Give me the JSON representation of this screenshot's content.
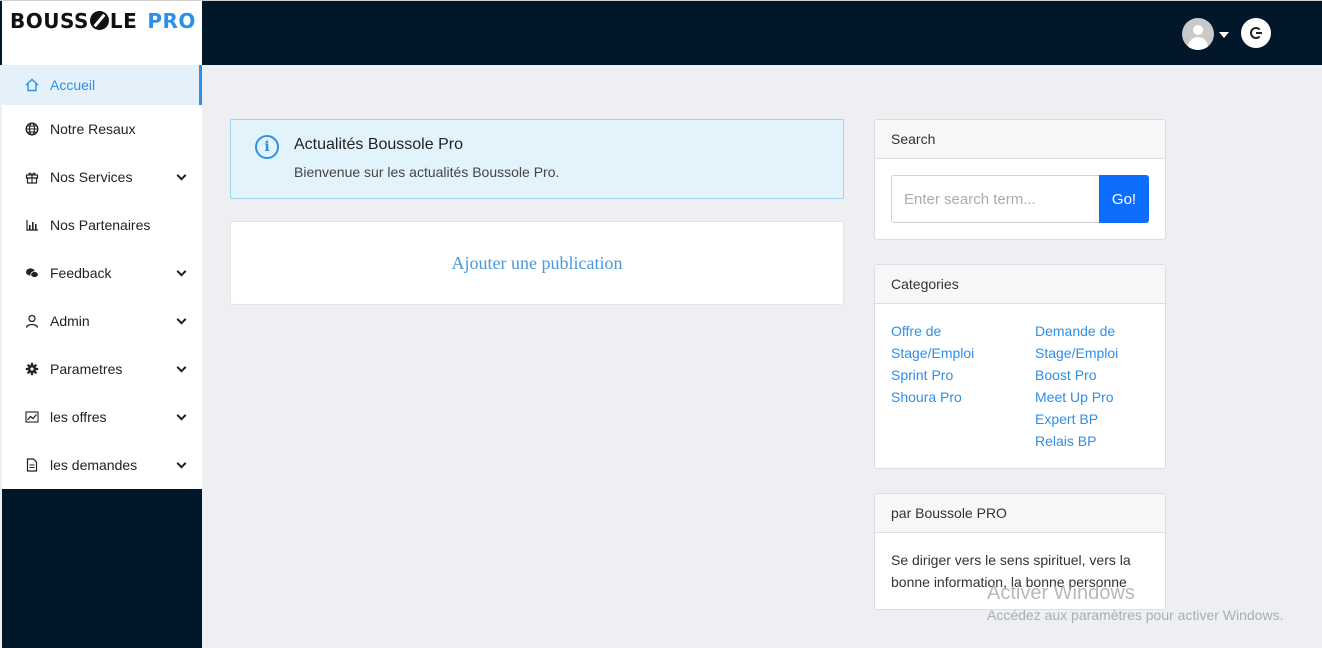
{
  "brand": {
    "name_part1": "BOUSS",
    "name_part2": "LE",
    "name_part3": "PRO"
  },
  "header": {
    "avatar_icon": "user-avatar-icon",
    "logout_icon": "logout-icon"
  },
  "sidebar": {
    "items": [
      {
        "label": "Accueil",
        "icon": "home-icon",
        "active": true,
        "expandable": false
      },
      {
        "label": "Notre Resaux",
        "icon": "globe-icon",
        "active": false,
        "expandable": false
      },
      {
        "label": "Nos Services",
        "icon": "gift-icon",
        "active": false,
        "expandable": true
      },
      {
        "label": "Nos Partenaires",
        "icon": "bar-chart-icon",
        "active": false,
        "expandable": false
      },
      {
        "label": "Feedback",
        "icon": "chat-icon",
        "active": false,
        "expandable": true
      },
      {
        "label": "Admin",
        "icon": "user-icon",
        "active": false,
        "expandable": true
      },
      {
        "label": "Parametres",
        "icon": "gear-icon",
        "active": false,
        "expandable": true
      },
      {
        "label": "les offres",
        "icon": "line-chart-icon",
        "active": false,
        "expandable": true
      },
      {
        "label": "les demandes",
        "icon": "document-icon",
        "active": false,
        "expandable": true
      }
    ]
  },
  "alert": {
    "title": "Actualités Boussole Pro",
    "text": "Bienvenue sur les actualités Boussole Pro.",
    "icon": "info-icon"
  },
  "publish": {
    "link_label": "Ajouter une publication"
  },
  "search_widget": {
    "title": "Search",
    "placeholder": "Enter search term...",
    "value": "",
    "button_label": "Go!"
  },
  "categories_widget": {
    "title": "Categories",
    "left": [
      "Offre de Stage/Emploi",
      "Sprint Pro",
      "Shoura Pro"
    ],
    "right": [
      "Demande de Stage/Emploi",
      "Boost Pro",
      "Meet Up Pro",
      "Expert BP",
      "Relais BP"
    ]
  },
  "about_widget": {
    "title": "par Boussole PRO",
    "text": "Se diriger vers le sens spirituel, vers la bonne information, la bonne personne"
  },
  "watermark": {
    "title": "Activer Windows",
    "text": "Accédez aux paramètres pour activer Windows."
  },
  "colors": {
    "topbar": "#03172b",
    "accent": "#2f8fe6",
    "button": "#0d6efd",
    "alert_bg": "#e3f3fc"
  }
}
